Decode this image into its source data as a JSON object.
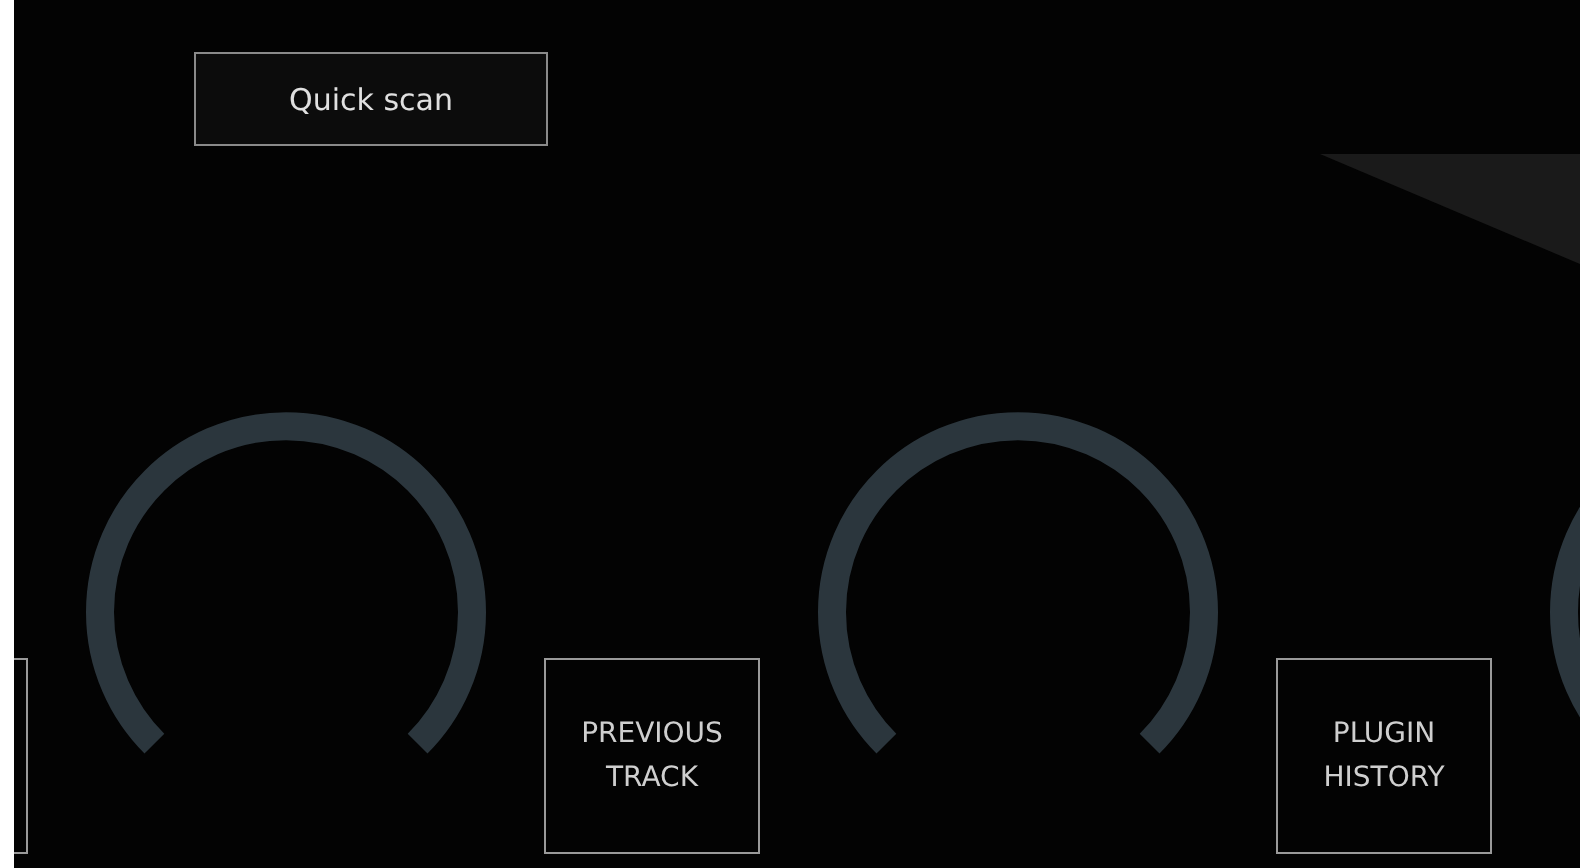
{
  "quick_scan": {
    "label": "Quick scan"
  },
  "controls": [
    {
      "kind": "button"
    },
    {
      "kind": "knob"
    },
    {
      "kind": "button",
      "label": "PREVIOUS\nTRACK"
    },
    {
      "kind": "knob"
    },
    {
      "kind": "button",
      "label": "PLUGIN\nHISTORY"
    },
    {
      "kind": "knob"
    }
  ]
}
